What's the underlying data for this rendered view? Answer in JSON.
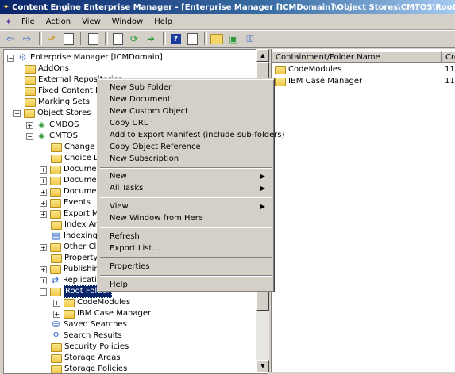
{
  "window": {
    "title": "Content Engine Enterprise Manager - [Enterprise Manager [ICMDomain]\\Object Stores\\CMTOS\\Root Folder]"
  },
  "menubar": {
    "items": [
      "File",
      "Action",
      "View",
      "Window",
      "Help"
    ]
  },
  "tree": {
    "root": "Enterprise Manager [ICMDomain]",
    "addons": "AddOns",
    "external": "External Repositories",
    "fixed": "Fixed Content De",
    "marking": "Marking Sets",
    "object_stores": "Object Stores",
    "cmdos": "CMDOS",
    "cmtos": "CMTOS",
    "change": "Change P",
    "choice": "Choice Lis",
    "doc1": "Documen",
    "doc2": "Documen",
    "doc3": "Documen",
    "events": "Events",
    "export": "Export Ma",
    "index_areas": "Index Are",
    "indexing": "Indexing",
    "other": "Other Cla",
    "property": "Property",
    "publishing": "Publishing",
    "replication": "Replicatio",
    "root_folder": "Root Folder",
    "codemodules": "CodeModules",
    "ibm": "IBM Case Manager",
    "saved": "Saved Searches",
    "search_results": "Search Results",
    "security": "Security Policies",
    "storage_areas": "Storage Areas",
    "storage_policies": "Storage Policies"
  },
  "list": {
    "columns": [
      "Containment/Folder Name",
      "Cre"
    ],
    "rows": [
      {
        "name": "CodeModules",
        "created": "11/"
      },
      {
        "name": "IBM Case Manager",
        "created": "11/"
      }
    ]
  },
  "context_menu": {
    "new_sub_folder": "New Sub Folder",
    "new_document": "New Document",
    "new_custom_object": "New Custom Object",
    "copy_url": "Copy URL",
    "add_export": "Add to Export Manifest (include sub-folders)",
    "copy_object_ref": "Copy Object Reference",
    "new_subscription": "New Subscription",
    "new": "New",
    "all_tasks": "All Tasks",
    "view": "View",
    "new_window": "New Window from Here",
    "refresh": "Refresh",
    "export_list": "Export List...",
    "properties": "Properties",
    "help": "Help"
  },
  "colors": {
    "title_start": "#0a246a",
    "title_end": "#a6caf0",
    "selection": "#0a246a",
    "folder": "#f5d66b"
  },
  "icons": [
    "app-icon",
    "back-icon",
    "forward-icon",
    "up-folder-icon",
    "show-hide-tree-icon",
    "copy-icon",
    "properties-icon",
    "refresh-icon",
    "export-icon",
    "help-icon",
    "view-icon",
    "new-folder-icon",
    "new-document-icon",
    "security-icon"
  ]
}
